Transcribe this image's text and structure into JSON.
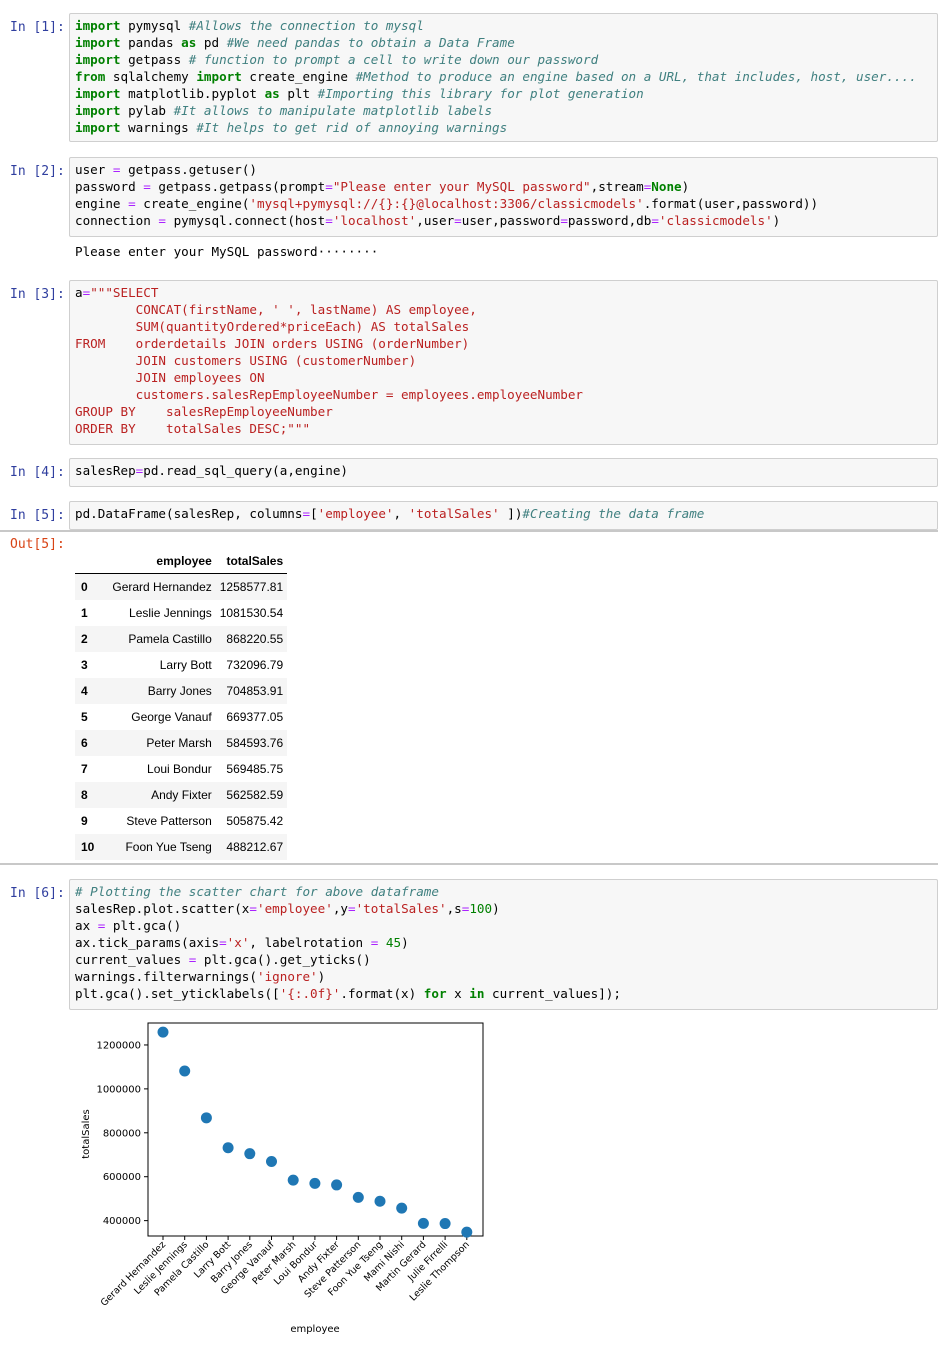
{
  "cells": [
    {
      "prompt": "In [1]:"
    },
    {
      "prompt": "In [2]:",
      "stdout": "Please enter your MySQL password········"
    },
    {
      "prompt": "In [3]:"
    },
    {
      "prompt": "In [4]:"
    },
    {
      "prompt": "In [5]:",
      "out_prompt": "Out[5]:"
    },
    {
      "prompt": "In [6]:"
    }
  ],
  "cell1_lines": [
    [
      [
        "kw",
        "import"
      ],
      [
        "t",
        " pymysql "
      ],
      [
        "cm",
        "#Allows the connection to mysql"
      ]
    ],
    [
      [
        "kw",
        "import"
      ],
      [
        "t",
        " pandas "
      ],
      [
        "kw",
        "as"
      ],
      [
        "t",
        " pd "
      ],
      [
        "cm",
        "#We need pandas to obtain a Data Frame"
      ]
    ],
    [
      [
        "kw",
        "import"
      ],
      [
        "t",
        " getpass "
      ],
      [
        "cm",
        "# function to prompt a cell to write down our password"
      ]
    ],
    [
      [
        "kw",
        "from"
      ],
      [
        "t",
        " sqlalchemy "
      ],
      [
        "kw",
        "import"
      ],
      [
        "t",
        " create_engine "
      ],
      [
        "cm",
        "#Method to produce an engine based on a URL, that includes, host, user...."
      ]
    ],
    [
      [
        "kw",
        "import"
      ],
      [
        "t",
        " matplotlib.pyplot "
      ],
      [
        "kw",
        "as"
      ],
      [
        "t",
        " plt "
      ],
      [
        "cm",
        "#Importing this library for plot generation"
      ]
    ],
    [
      [
        "kw",
        "import"
      ],
      [
        "t",
        " pylab "
      ],
      [
        "cm",
        "#It allows to manipulate matplotlib labels"
      ]
    ],
    [
      [
        "kw",
        "import"
      ],
      [
        "t",
        " warnings "
      ],
      [
        "cm",
        "#It helps to get rid of annoying warnings"
      ]
    ]
  ],
  "cell2_lines": [
    [
      [
        "t",
        "user "
      ],
      [
        "op",
        "="
      ],
      [
        "t",
        " getpass.getuser()"
      ]
    ],
    [
      [
        "t",
        "password "
      ],
      [
        "op",
        "="
      ],
      [
        "t",
        " getpass.getpass(prompt"
      ],
      [
        "op",
        "="
      ],
      [
        "st",
        "\"Please enter your MySQL password\""
      ],
      [
        "t",
        ",stream"
      ],
      [
        "op",
        "="
      ],
      [
        "kw",
        "None"
      ],
      [
        "t",
        ")"
      ]
    ],
    [
      [
        "t",
        "engine "
      ],
      [
        "op",
        "="
      ],
      [
        "t",
        " create_engine("
      ],
      [
        "st",
        "'mysql+pymysql://{}:{}@localhost:3306/classicmodels'"
      ],
      [
        "t",
        ".format(user,password))"
      ]
    ],
    [
      [
        "t",
        "connection "
      ],
      [
        "op",
        "="
      ],
      [
        "t",
        " pymysql.connect(host"
      ],
      [
        "op",
        "="
      ],
      [
        "st",
        "'localhost'"
      ],
      [
        "t",
        ",user"
      ],
      [
        "op",
        "="
      ],
      [
        "t",
        "user,password"
      ],
      [
        "op",
        "="
      ],
      [
        "t",
        "password,db"
      ],
      [
        "op",
        "="
      ],
      [
        "st",
        "'classicmodels'"
      ],
      [
        "t",
        ")"
      ]
    ]
  ],
  "cell3_lines": [
    [
      [
        "t",
        "a"
      ],
      [
        "op",
        "="
      ],
      [
        "st",
        "\"\"\"SELECT"
      ]
    ],
    [
      [
        "st",
        "        CONCAT(firstName, ' ', lastName) AS employee,"
      ]
    ],
    [
      [
        "st",
        "        SUM(quantityOrdered*priceEach) AS totalSales"
      ]
    ],
    [
      [
        "st",
        "FROM    orderdetails JOIN orders USING (orderNumber)"
      ]
    ],
    [
      [
        "st",
        "        JOIN customers USING (customerNumber)"
      ]
    ],
    [
      [
        "st",
        "        JOIN employees ON"
      ]
    ],
    [
      [
        "st",
        "        customers.salesRepEmployeeNumber = employees.employeeNumber"
      ]
    ],
    [
      [
        "st",
        "GROUP BY    salesRepEmployeeNumber"
      ]
    ],
    [
      [
        "st",
        "ORDER BY    totalSales DESC;\"\"\""
      ]
    ]
  ],
  "cell4_lines": [
    [
      [
        "t",
        "salesRep"
      ],
      [
        "op",
        "="
      ],
      [
        "t",
        "pd.read_sql_query(a,engine)"
      ]
    ]
  ],
  "cell5_lines": [
    [
      [
        "t",
        "pd.DataFrame(salesRep, columns"
      ],
      [
        "op",
        "="
      ],
      [
        "t",
        "["
      ],
      [
        "st",
        "'employee'"
      ],
      [
        "t",
        ", "
      ],
      [
        "st",
        "'totalSales'"
      ],
      [
        "t",
        " ])"
      ],
      [
        "cm",
        "#Creating the data frame"
      ]
    ]
  ],
  "cell6_lines": [
    [
      [
        "cm",
        "# Plotting the scatter chart for above dataframe"
      ]
    ],
    [
      [
        "t",
        "salesRep.plot.scatter(x"
      ],
      [
        "op",
        "="
      ],
      [
        "st",
        "'employee'"
      ],
      [
        "t",
        ",y"
      ],
      [
        "op",
        "="
      ],
      [
        "st",
        "'totalSales'"
      ],
      [
        "t",
        ",s"
      ],
      [
        "op",
        "="
      ],
      [
        "nm",
        "100"
      ],
      [
        "t",
        ")"
      ]
    ],
    [
      [
        "t",
        "ax "
      ],
      [
        "op",
        "="
      ],
      [
        "t",
        " plt.gca()"
      ]
    ],
    [
      [
        "t",
        "ax.tick_params(axis"
      ],
      [
        "op",
        "="
      ],
      [
        "st",
        "'x'"
      ],
      [
        "t",
        ", labelrotation "
      ],
      [
        "op",
        "="
      ],
      [
        "t",
        " "
      ],
      [
        "nm",
        "45"
      ],
      [
        "t",
        ")"
      ]
    ],
    [
      [
        "t",
        "current_values "
      ],
      [
        "op",
        "="
      ],
      [
        "t",
        " plt.gca().get_yticks()"
      ]
    ],
    [
      [
        "t",
        "warnings.filterwarnings("
      ],
      [
        "st",
        "'ignore'"
      ],
      [
        "t",
        ")"
      ]
    ],
    [
      [
        "t",
        "plt.gca().set_yticklabels(["
      ],
      [
        "st",
        "'{:.0f}'"
      ],
      [
        "t",
        ".format(x) "
      ],
      [
        "kw",
        "for"
      ],
      [
        "t",
        " x "
      ],
      [
        "kw",
        "in"
      ],
      [
        "t",
        " current_values]);"
      ]
    ]
  ],
  "dataframe": {
    "columns": [
      "employee",
      "totalSales"
    ],
    "rows": [
      {
        "index": "0",
        "employee": "Gerard Hernandez",
        "totalSales": "1258577.81"
      },
      {
        "index": "1",
        "employee": "Leslie Jennings",
        "totalSales": "1081530.54"
      },
      {
        "index": "2",
        "employee": "Pamela Castillo",
        "totalSales": "868220.55"
      },
      {
        "index": "3",
        "employee": "Larry Bott",
        "totalSales": "732096.79"
      },
      {
        "index": "4",
        "employee": "Barry Jones",
        "totalSales": "704853.91"
      },
      {
        "index": "5",
        "employee": "George Vanauf",
        "totalSales": "669377.05"
      },
      {
        "index": "6",
        "employee": "Peter Marsh",
        "totalSales": "584593.76"
      },
      {
        "index": "7",
        "employee": "Loui Bondur",
        "totalSales": "569485.75"
      },
      {
        "index": "8",
        "employee": "Andy Fixter",
        "totalSales": "562582.59"
      },
      {
        "index": "9",
        "employee": "Steve Patterson",
        "totalSales": "505875.42"
      },
      {
        "index": "10",
        "employee": "Foon Yue Tseng",
        "totalSales": "488212.67"
      }
    ]
  },
  "chart_data": {
    "type": "scatter",
    "xlabel": "employee",
    "ylabel": "totalSales",
    "x": [
      "Gerard Hernandez",
      "Leslie Jennings",
      "Pamela Castillo",
      "Larry Bott",
      "Barry Jones",
      "George Vanauf",
      "Peter Marsh",
      "Loui Bondur",
      "Andy Fixter",
      "Steve Patterson",
      "Foon Yue Tseng",
      "Mami Nishi",
      "Martin Gerard",
      "Julie Firrelli",
      "Leslie Thompson"
    ],
    "y": [
      1258577.81,
      1081530.54,
      868220.55,
      732096.79,
      704853.91,
      669377.05,
      584593.76,
      569485.75,
      562582.59,
      505875.42,
      488212.67,
      457110.07,
      387477.47,
      386663.2,
      347533.03
    ],
    "yticks": [
      "400000",
      "600000",
      "800000",
      "1000000",
      "1200000"
    ],
    "ylim": [
      330000,
      1300000
    ],
    "point_color": "#1f77b4",
    "grid": false,
    "xtick_rotation_deg": 45
  }
}
